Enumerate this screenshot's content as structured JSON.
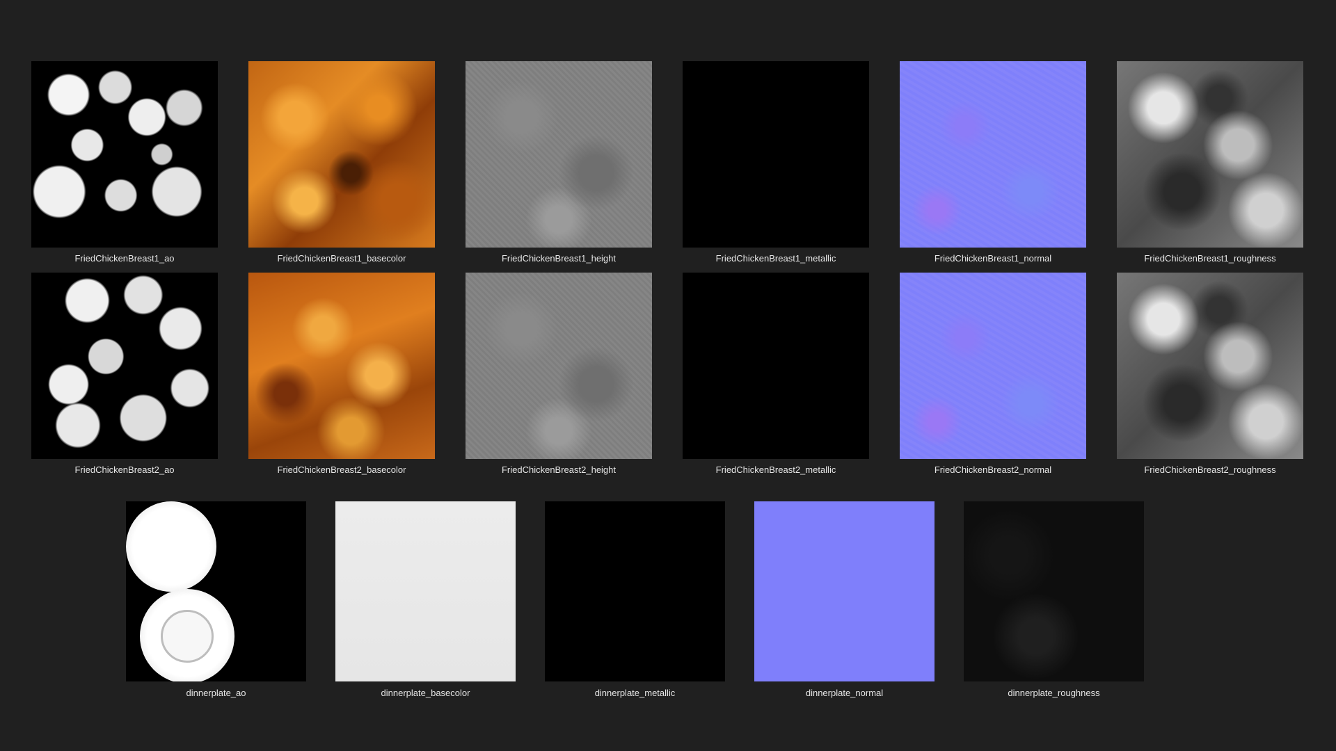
{
  "background_color": "#202020",
  "caption_color": "#e6e6e6",
  "rows": [
    {
      "tiles": [
        {
          "label": "FriedChickenBreast1_ao",
          "look": "ao"
        },
        {
          "label": "FriedChickenBreast1_basecolor",
          "look": "base"
        },
        {
          "label": "FriedChickenBreast1_height",
          "look": "height"
        },
        {
          "label": "FriedChickenBreast1_metallic",
          "look": "metal"
        },
        {
          "label": "FriedChickenBreast1_normal",
          "look": "normal"
        },
        {
          "label": "FriedChickenBreast1_roughness",
          "look": "rough"
        }
      ]
    },
    {
      "tiles": [
        {
          "label": "FriedChickenBreast2_ao",
          "look": "ao2"
        },
        {
          "label": "FriedChickenBreast2_basecolor",
          "look": "base2"
        },
        {
          "label": "FriedChickenBreast2_height",
          "look": "height"
        },
        {
          "label": "FriedChickenBreast2_metallic",
          "look": "metal"
        },
        {
          "label": "FriedChickenBreast2_normal",
          "look": "normal"
        },
        {
          "label": "FriedChickenBreast2_roughness",
          "look": "rough"
        }
      ]
    },
    {
      "tiles": [
        {
          "label": "dinnerplate_ao",
          "look": "plate-ao"
        },
        {
          "label": "dinnerplate_basecolor",
          "look": "plate-base"
        },
        {
          "label": "dinnerplate_metallic",
          "look": "plate-metal"
        },
        {
          "label": "dinnerplate_normal",
          "look": "plate-normal"
        },
        {
          "label": "dinnerplate_roughness",
          "look": "plate-rough"
        }
      ]
    }
  ]
}
